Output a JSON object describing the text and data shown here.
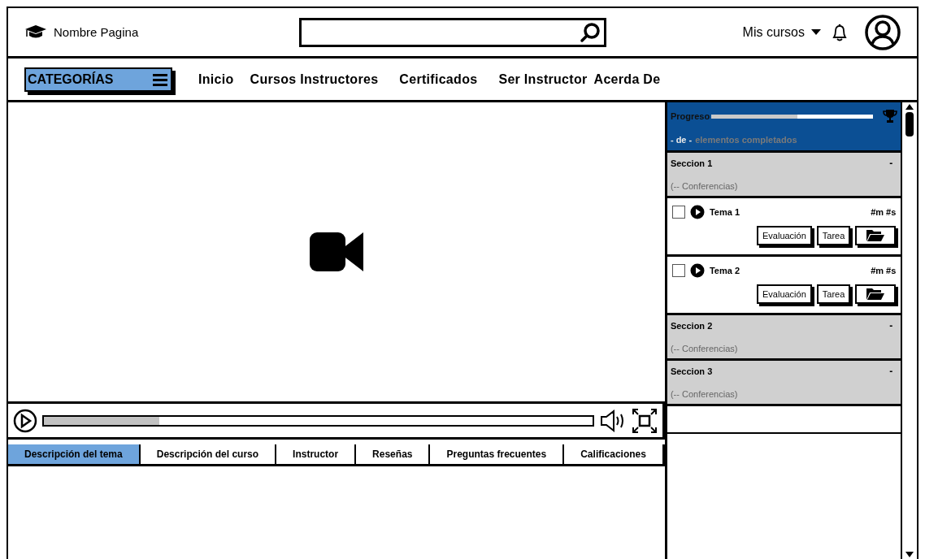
{
  "header": {
    "brand": "Nombre Pagina",
    "user_menu": "Mis cursos"
  },
  "nav": {
    "categories": "CATEGORÍAS",
    "links": [
      "Inicio",
      "Cursos Instructores",
      "Certificados",
      "Ser Instructor",
      "Acerda De"
    ]
  },
  "player": {
    "progress": {
      "level": 0.21
    }
  },
  "tabs": [
    {
      "label": "Descripción del tema",
      "selected": true
    },
    {
      "label": "Descripción del curso",
      "selected": false
    },
    {
      "label": "Instructor",
      "selected": false
    },
    {
      "label": "Reseñas",
      "selected": false
    },
    {
      "label": "Preguntas frecuentes",
      "selected": false
    },
    {
      "label": "Calificaciones",
      "selected": false
    }
  ],
  "sidebar": {
    "progress": {
      "label": "Progreso",
      "level": 0.53,
      "count": "- de -",
      "summary": "elementos completados"
    },
    "sections": [
      {
        "title": "Seccion 1",
        "toggle": "-",
        "subtitle": "(-- Conferencias)",
        "topics": [
          {
            "title": "Tema 1",
            "checked": false,
            "duration": "#m #s",
            "buttons": [
              "Evaluación",
              "Tarea"
            ]
          },
          {
            "title": "Tema 2",
            "checked": false,
            "duration": "#m #s",
            "buttons": [
              "Evaluación",
              "Tarea"
            ]
          }
        ]
      },
      {
        "title": "Seccion 2",
        "toggle": "-",
        "subtitle": "(-- Conferencias)"
      },
      {
        "title": "Seccion 3",
        "toggle": "-",
        "subtitle": "(-- Conferencias)"
      }
    ]
  }
}
